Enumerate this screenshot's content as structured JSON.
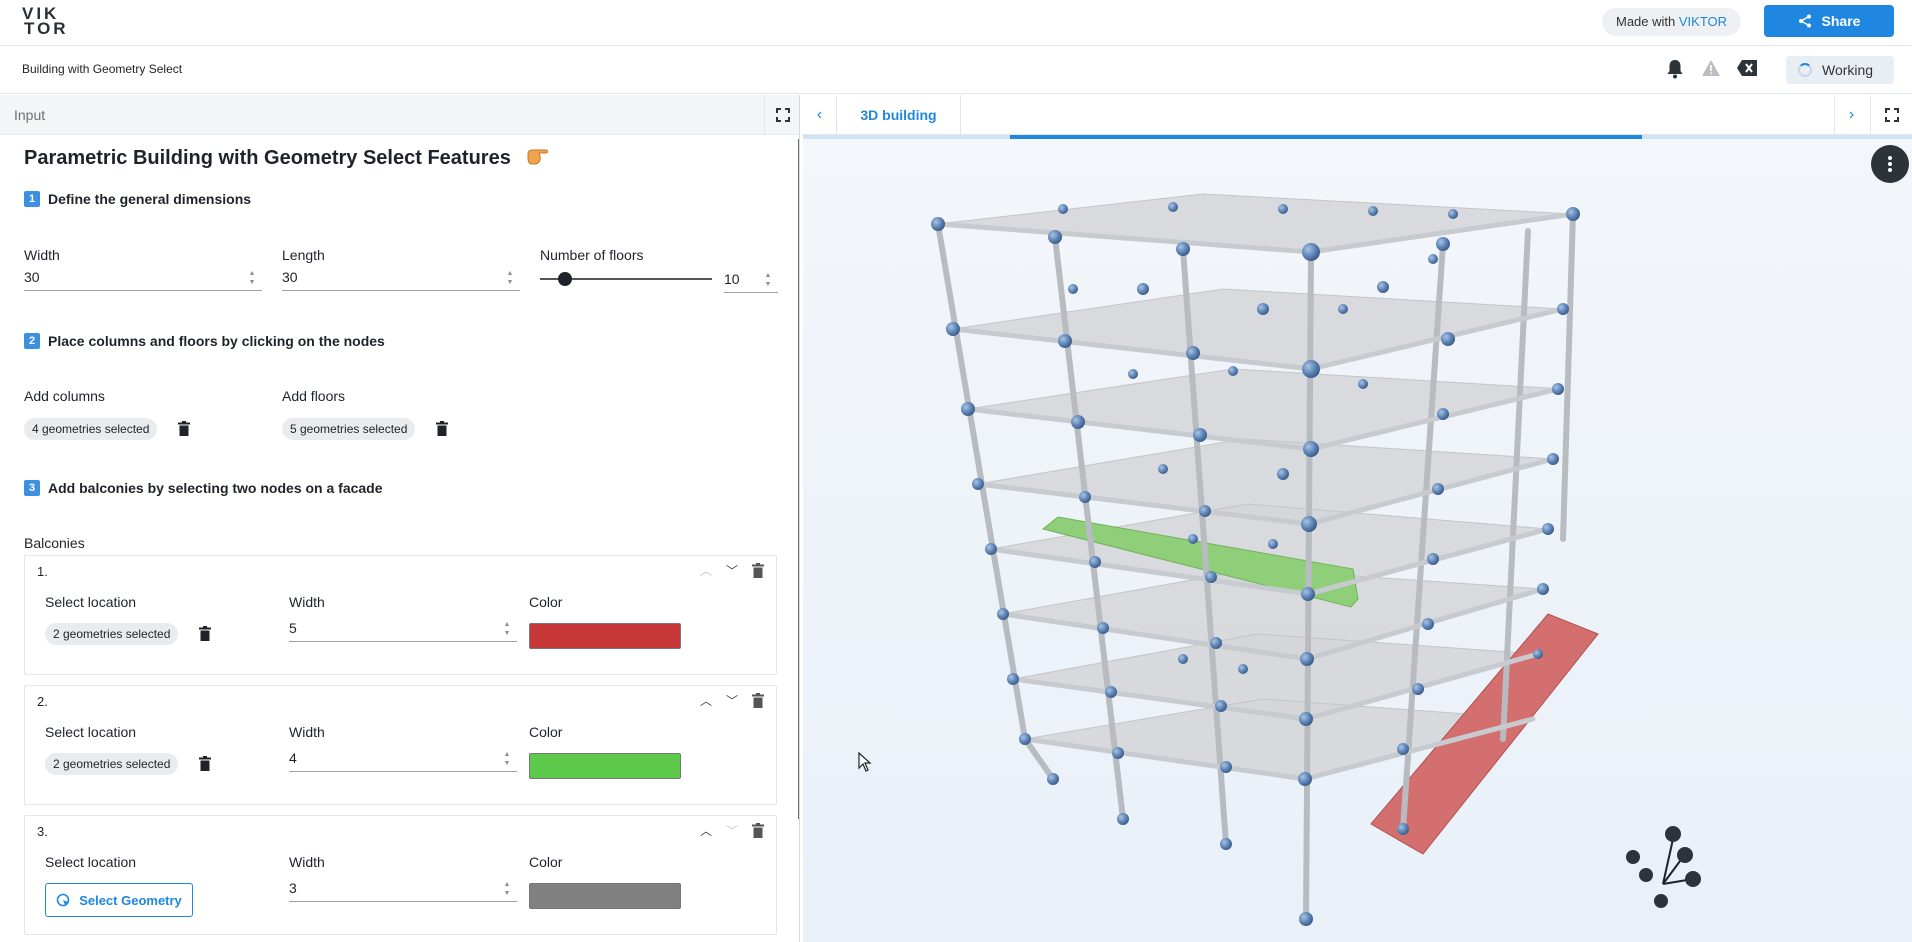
{
  "topbar": {
    "logo_line1": "VIK",
    "logo_line2": "TOR",
    "made_with_prefix": "Made with ",
    "made_with_brand": "VIKTOR",
    "share_label": "Share"
  },
  "appbar": {
    "title": "Building with Geometry Select",
    "status": "Working"
  },
  "left_panel": {
    "header": "Input",
    "title": "Parametric Building with Geometry Select Features",
    "step1": {
      "number": "1",
      "label": "Define the general dimensions"
    },
    "width": {
      "label": "Width",
      "value": "30"
    },
    "length": {
      "label": "Length",
      "value": "30"
    },
    "floors": {
      "label": "Number of floors",
      "value": "10"
    },
    "step2": {
      "number": "2",
      "label": "Place columns and floors by clicking on the nodes"
    },
    "add_columns": {
      "label": "Add columns",
      "chip": "4 geometries selected"
    },
    "add_floors": {
      "label": "Add floors",
      "chip": "5 geometries selected"
    },
    "step3": {
      "number": "3",
      "label": "Add balconies by selecting two nodes on a facade"
    },
    "balconies_label": "Balconies",
    "balconies": [
      {
        "index": "1.",
        "location_label": "Select location",
        "location_chip": "2 geometries selected",
        "width_label": "Width",
        "width_value": "5",
        "color_label": "Color",
        "color": "#c93838"
      },
      {
        "index": "2.",
        "location_label": "Select location",
        "location_chip": "2 geometries selected",
        "width_label": "Width",
        "width_value": "4",
        "color_label": "Color",
        "color": "#5cc94a"
      },
      {
        "index": "3.",
        "location_label": "Select location",
        "select_button": "Select Geometry",
        "width_label": "Width",
        "width_value": "3",
        "color_label": "Color",
        "color": "#808080"
      }
    ]
  },
  "right_panel": {
    "tab_label": "3D building"
  },
  "colors": {
    "accent": "#1f87e0",
    "balcony_red": "#c93838",
    "balcony_green": "#5cc94a",
    "balcony_grey": "#808080"
  },
  "icons": [
    "share-icon",
    "bell-icon",
    "warning-icon",
    "clear-icon",
    "spinner-icon",
    "fullscreen-icon",
    "chevron-left-icon",
    "chevron-right-icon",
    "trash-icon",
    "chevron-up-icon",
    "chevron-down-icon",
    "select-geometry-icon",
    "menu-dots-icon",
    "axes-gizmo-icon",
    "cursor-icon",
    "pointing-hand-icon"
  ]
}
